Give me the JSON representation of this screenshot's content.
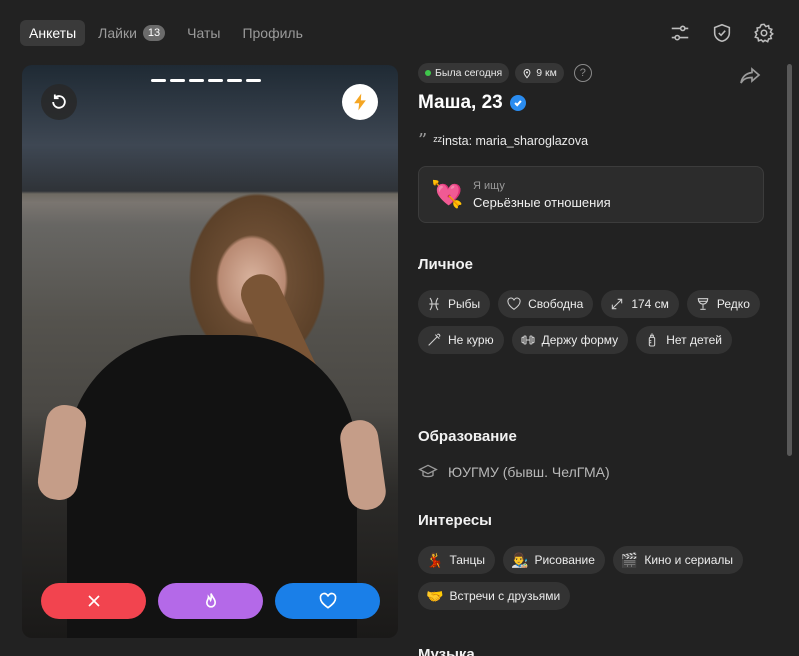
{
  "nav": {
    "tabs": [
      {
        "label": "Анкеты",
        "active": true
      },
      {
        "label": "Лайки",
        "badge": "13"
      },
      {
        "label": "Чаты"
      },
      {
        "label": "Профиль"
      }
    ],
    "icons": [
      "filters-icon",
      "shield-check-icon",
      "gear-icon"
    ]
  },
  "photo": {
    "progress_segments": 6,
    "undo_icon": "undo-icon",
    "boost_icon": "lightning-icon",
    "actions": [
      "dislike-x-icon",
      "superlike-flame-icon",
      "like-heart-icon"
    ],
    "colors": {
      "dislike": "#f2444f",
      "superlike": "#b469e8",
      "like": "#1a7fe8",
      "boost": "#f5a623"
    }
  },
  "profile": {
    "status": "Была сегодня",
    "distance": "9 км",
    "help": "?",
    "name": "Маша, 23",
    "bio": "ᶻᶻinsta: maria_sharoglazova",
    "seek_label": "Я ищу",
    "seek_value": "Серьёзные отношения",
    "seek_emoji": "💘"
  },
  "sections": {
    "personal": "Личное",
    "education": "Образование",
    "interests": "Интересы",
    "music": "Музыка"
  },
  "personal_chips": [
    {
      "icon": "pisces-icon",
      "label": "Рыбы"
    },
    {
      "icon": "heart-outline-icon",
      "label": "Свободна"
    },
    {
      "icon": "height-arrows-icon",
      "label": "174 см"
    },
    {
      "icon": "wine-glass-icon",
      "label": "Редко"
    },
    {
      "icon": "no-smoking-icon",
      "label": "Не курю"
    },
    {
      "icon": "dumbbell-icon",
      "label": "Держу форму"
    },
    {
      "icon": "baby-bottle-icon",
      "label": "Нет детей"
    }
  ],
  "education": {
    "icon": "graduation-cap-icon",
    "value": "ЮУГМУ (бывш. ЧелГМА)"
  },
  "interests": [
    {
      "emoji": "💃",
      "label": "Танцы"
    },
    {
      "emoji": "👨‍🎨",
      "label": "Рисование"
    },
    {
      "emoji": "🎬",
      "label": "Кино и сериалы"
    },
    {
      "emoji": "🤝",
      "label": "Встречи с друзьями"
    }
  ]
}
